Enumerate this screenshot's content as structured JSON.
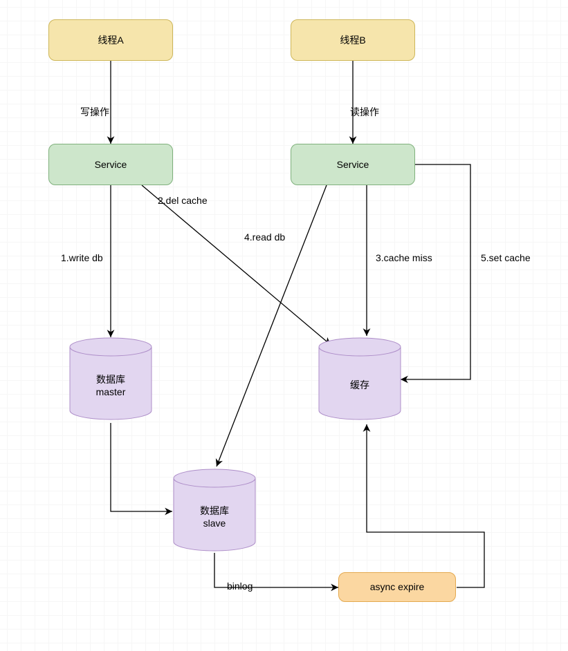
{
  "nodes": {
    "thread_a": "线程A",
    "thread_b": "线程B",
    "service_a": "Service",
    "service_b": "Service",
    "db_master": "数据库\nmaster",
    "db_slave": "数据库\nslave",
    "cache": "缓存",
    "async": "async expire"
  },
  "edges": {
    "write_op": "写操作",
    "read_op": "读操作",
    "e1": "1.write db",
    "e2": "2.del cache",
    "e3": "3.cache miss",
    "e4": "4.read db",
    "e5": "5.set cache",
    "binlog": "binlog"
  },
  "colors": {
    "yellow_fill": "#f6e5ac",
    "yellow_stroke": "#cdb659",
    "green_fill": "#cde6cb",
    "green_stroke": "#7fb07c",
    "purple_fill": "#e2d6f0",
    "purple_stroke": "#ad8dc8",
    "orange_fill": "#fbd7a1",
    "orange_stroke": "#e3a84e",
    "arrow": "#000000",
    "grid_minor": "#f6f6f6",
    "grid_major": "#eceef0"
  }
}
